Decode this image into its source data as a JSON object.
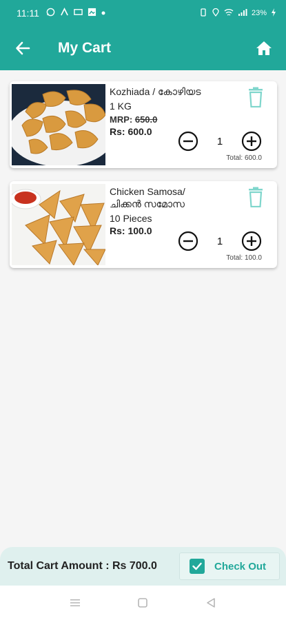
{
  "status_bar": {
    "time": "11:11",
    "battery": "23%"
  },
  "app_bar": {
    "title": "My Cart",
    "back_icon": "arrow-left-icon",
    "home_icon": "home-icon"
  },
  "cart_items": [
    {
      "name": "Kozhiada / കോഴിയട",
      "quantity_label": "1 KG",
      "mrp_prefix": "MRP: ",
      "mrp_value": "650.0",
      "price": "Rs: 600.0",
      "count": "1",
      "total": "Total: 600.0"
    },
    {
      "name": "Chicken Samosa/ ചിക്കൻ സമോസ",
      "quantity_label": "10 Pieces",
      "price": "Rs: 100.0",
      "count": "1",
      "total": "Total: 100.0"
    }
  ],
  "footer": {
    "total_label": "Total Cart Amount : Rs 700.0",
    "checkout_label": "Check Out"
  },
  "colors": {
    "primary": "#21a89a",
    "delete": "#7fd6cc"
  }
}
